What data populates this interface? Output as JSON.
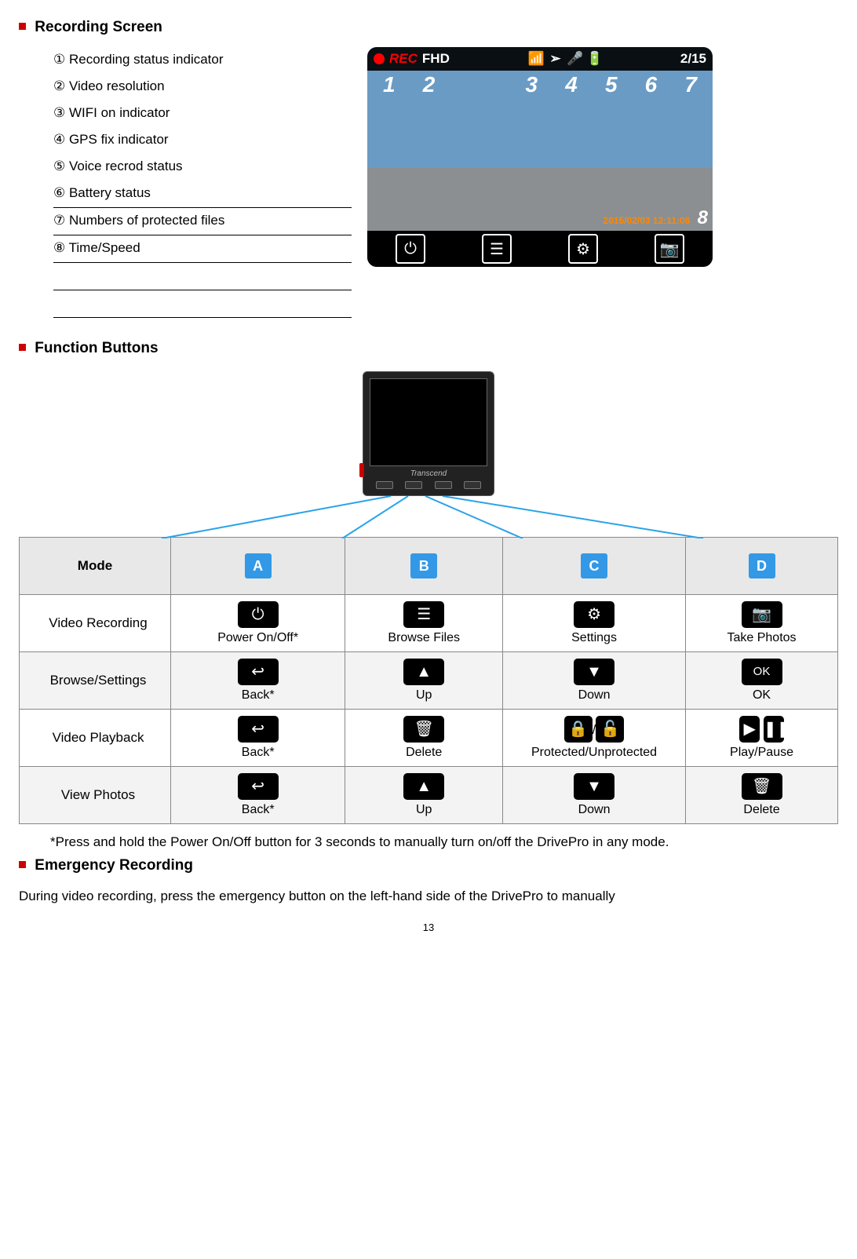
{
  "sections": {
    "recording": {
      "title": "Recording Screen"
    },
    "functions": {
      "title": "Function Buttons"
    },
    "emergency": {
      "title": "Emergency Recording",
      "body": "During video recording, press the emergency button on the left-hand side of the DrivePro to manually"
    }
  },
  "indicators": [
    "① Recording status indicator",
    "② Video resolution",
    "③ WIFI on indicator",
    "④ GPS fix indicator",
    "⑤ Voice recrod status",
    "⑥ Battery status",
    "⑦ Numbers of protected files",
    "⑧ Time/Speed"
  ],
  "screen": {
    "rec": "REC",
    "res": "FHD",
    "protected_count": "2/15",
    "callouts": [
      "1",
      "2",
      "3",
      "4",
      "5",
      "6",
      "7"
    ],
    "right_num": "8",
    "timestamp": "2015/02/03  12:11:08",
    "device_brand": "Transcend"
  },
  "functions_table": {
    "header": [
      "Mode",
      "A",
      "B",
      "C",
      "D"
    ],
    "rows": [
      {
        "mode": "Video Recording",
        "cells": [
          {
            "icon": "power",
            "label": "Power On/Off*"
          },
          {
            "icon": "list",
            "label": "Browse Files"
          },
          {
            "icon": "gear",
            "label": "Settings"
          },
          {
            "icon": "camera",
            "label": "Take Photos"
          }
        ]
      },
      {
        "mode": "Browse/Settings",
        "cells": [
          {
            "icon": "back",
            "label": "Back*"
          },
          {
            "icon": "up",
            "label": "Up"
          },
          {
            "icon": "down",
            "label": "Down"
          },
          {
            "icon": "ok",
            "label": "OK"
          }
        ]
      },
      {
        "mode": "Video Playback",
        "cells": [
          {
            "icon": "back",
            "label": "Back*"
          },
          {
            "icon": "trash",
            "label": "Delete"
          },
          {
            "icon": "loctoggle",
            "label": "Protected/Unprotected"
          },
          {
            "icon": "playpause",
            "label": "Play/Pause"
          }
        ]
      },
      {
        "mode": "View Photos",
        "cells": [
          {
            "icon": "back",
            "label": "Back*"
          },
          {
            "icon": "up",
            "label": "Up"
          },
          {
            "icon": "down",
            "label": "Down"
          },
          {
            "icon": "trash",
            "label": "Delete"
          }
        ]
      }
    ],
    "note": "*Press and hold the Power On/Off button for 3 seconds to manually turn on/off the DrivePro in any mode."
  },
  "page_number": "13"
}
